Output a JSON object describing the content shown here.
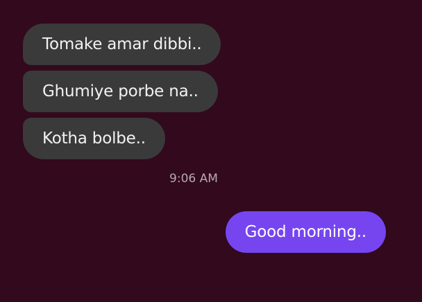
{
  "conversation": {
    "incoming": [
      {
        "text": "Tomake amar dibbi.."
      },
      {
        "text": "Ghumiye porbe na.."
      },
      {
        "text": "Kotha bolbe.."
      }
    ],
    "timestamp": "9:06 AM",
    "outgoing": [
      {
        "text": "Good morning.."
      }
    ]
  },
  "colors": {
    "background": "#32091d",
    "incoming_bubble": "#3a3a3a",
    "outgoing_bubble": "#7645f0",
    "timestamp_text": "#b8a9b1"
  }
}
